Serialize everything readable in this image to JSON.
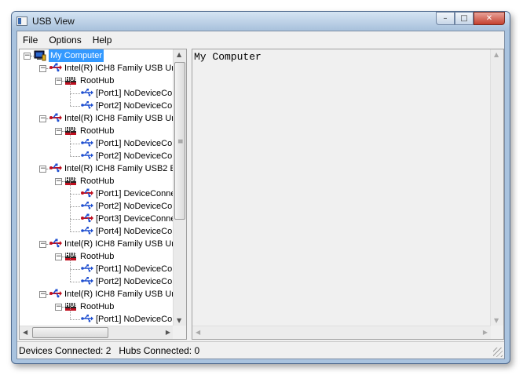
{
  "window": {
    "title": "USB View"
  },
  "caption_buttons": {
    "minimize": "–",
    "maximize": "□",
    "close": "✕"
  },
  "menu": [
    "File",
    "Options",
    "Help"
  ],
  "tree": [
    {
      "label": "My Computer",
      "icon": "computer-icon",
      "selected": true
    },
    {
      "label": "Intel(R) ICH8 Family USB Un",
      "icon": "usb-controller-icon"
    },
    {
      "label": "RootHub",
      "icon": "hub-icon"
    },
    {
      "label": "[Port1] NoDeviceCo",
      "icon": "usb-port-icon"
    },
    {
      "label": "[Port2] NoDeviceCo",
      "icon": "usb-port-icon"
    },
    {
      "label": "Intel(R) ICH8 Family USB Un",
      "icon": "usb-controller-icon"
    },
    {
      "label": "RootHub",
      "icon": "hub-icon"
    },
    {
      "label": "[Port1] NoDeviceCo",
      "icon": "usb-port-icon"
    },
    {
      "label": "[Port2] NoDeviceCo",
      "icon": "usb-port-icon"
    },
    {
      "label": "Intel(R) ICH8 Family USB2 E",
      "icon": "usb-controller-icon"
    },
    {
      "label": "RootHub",
      "icon": "hub-icon"
    },
    {
      "label": "[Port1] DeviceConne",
      "icon": "usb-device-icon"
    },
    {
      "label": "[Port2] NoDeviceCo",
      "icon": "usb-port-icon"
    },
    {
      "label": "[Port3] DeviceConne",
      "icon": "usb-device-icon"
    },
    {
      "label": "[Port4] NoDeviceCo",
      "icon": "usb-port-icon"
    },
    {
      "label": "Intel(R) ICH8 Family USB Un",
      "icon": "usb-controller-icon"
    },
    {
      "label": "RootHub",
      "icon": "hub-icon"
    },
    {
      "label": "[Port1] NoDeviceCo",
      "icon": "usb-port-icon"
    },
    {
      "label": "[Port2] NoDeviceCo",
      "icon": "usb-port-icon"
    },
    {
      "label": "Intel(R) ICH8 Family USB Un",
      "icon": "usb-controller-icon"
    },
    {
      "label": "RootHub",
      "icon": "hub-icon"
    },
    {
      "label": "[Port1] NoDeviceCo",
      "icon": "usb-port-icon"
    }
  ],
  "hub_icon_text": "HUB",
  "detail": {
    "text": "My Computer"
  },
  "status": {
    "text": "Devices Connected: 2   Hubs Connected: 0"
  },
  "colors": {
    "selection": "#3399ff",
    "usb_device": "#c01020",
    "usb_port": "#1f4fd0"
  }
}
